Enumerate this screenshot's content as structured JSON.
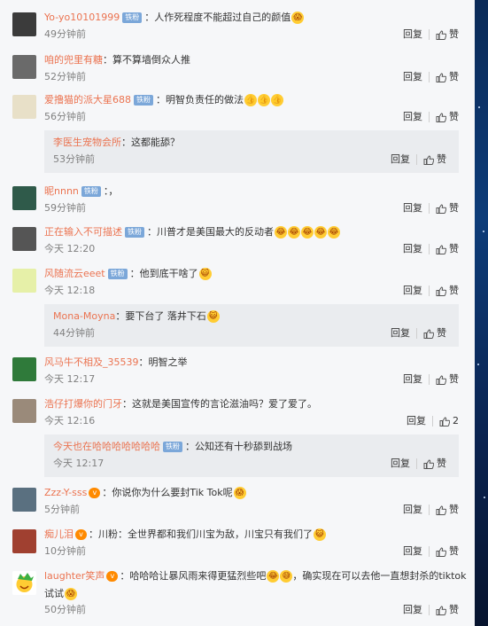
{
  "actions": {
    "reply": "回复",
    "like": "赞"
  },
  "comments": [
    {
      "user": "Yo-yo10101999",
      "badge": "铁粉",
      "text": "：人作死程度不能超过自己的颜值",
      "emoji": [
        "😱"
      ],
      "time": "49分钟前",
      "like": "赞"
    },
    {
      "user": "咱的兜里有糖",
      "badge": "",
      "text": "：算不算墙倒众人推",
      "emoji": [],
      "time": "52分钟前",
      "like": "赞"
    },
    {
      "user": "爱撸猫的派大星688",
      "badge": "铁粉",
      "text": "：明智负责任的做法",
      "emoji": [
        "👍",
        "👍",
        "👍"
      ],
      "time": "56分钟前",
      "like": "赞",
      "reply": {
        "user": "李医生宠物会所",
        "text": "：这都能舔？",
        "time": "53分钟前",
        "like": "赞"
      }
    },
    {
      "user": "昵nnnn",
      "badge": "铁粉",
      "text": "：，",
      "emoji": [],
      "time": "59分钟前",
      "like": "赞"
    },
    {
      "user": "正在输入不可描述",
      "badge": "铁粉",
      "text": "：川普才是美国最大的反动者",
      "emoji": [
        "😂",
        "😂",
        "😂",
        "😂",
        "😂"
      ],
      "time": "今天 12:20",
      "like": "赞"
    },
    {
      "user": "风随流云eeet",
      "badge": "铁粉",
      "text": "：他到底干啥了",
      "emoji": [
        "😺"
      ],
      "time": "今天 12:18",
      "like": "赞",
      "reply": {
        "user": "Mona-Moyna",
        "text": "：要下台了 落井下石",
        "emoji": [
          "😺"
        ],
        "time": "44分钟前",
        "like": "赞"
      }
    },
    {
      "user": "风马牛不相及_35539",
      "badge": "",
      "text": "：明智之举",
      "emoji": [],
      "time": "今天 12:17",
      "like": "赞"
    },
    {
      "user": "浩仔打爆你的门牙",
      "badge": "",
      "text": "：这就是美国宣传的言论滋油吗？爱了爱了。",
      "emoji": [],
      "time": "今天 12:16",
      "like": "2",
      "reply": {
        "user": "今天也在哈哈哈哈哈哈哈",
        "badge": "铁粉",
        "text": "：公知还有十秒舔到战场",
        "time": "今天 12:17",
        "like": "赞"
      }
    },
    {
      "user": "Zzz-Y-sss",
      "badge": "",
      "vip": "v",
      "text": "：你说你为什么要封Tik Tok呢",
      "emoji": [
        "😱"
      ],
      "time": "5分钟前",
      "like": "赞"
    },
    {
      "user": "痴儿泪",
      "badge": "",
      "vip": "v",
      "text": "：川粉：全世界都和我们川宝为敌，川宝只有我们了",
      "emoji": [
        "😺"
      ],
      "time": "10分钟前",
      "like": "赞"
    },
    {
      "user": "laughter笑声",
      "badge": "",
      "vip": "v",
      "text": "：哈哈哈让暴风雨来得更猛烈些吧",
      "emoji": [
        "😂",
        "😅"
      ],
      "text2": "，确实现在可以去他一直想封杀的tiktok",
      "text3": "试试",
      "emoji3": [
        "😱"
      ],
      "time": "50分钟前",
      "like": "赞"
    }
  ]
}
